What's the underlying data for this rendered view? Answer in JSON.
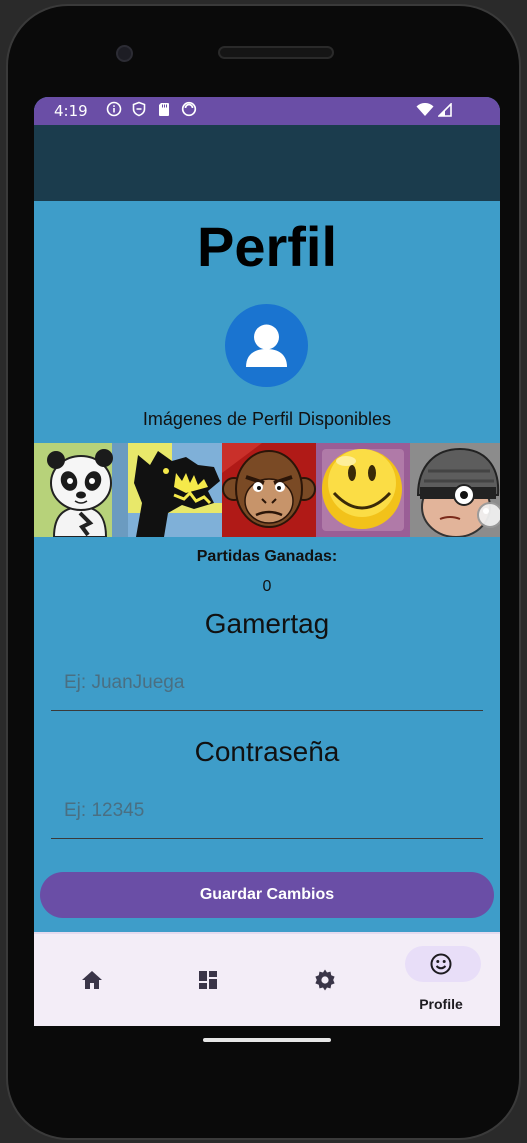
{
  "status_bar": {
    "time": "4:19",
    "icons": [
      "info-icon",
      "vpn-shield-icon",
      "sd-card-icon",
      "app-icon",
      "wifi-icon",
      "signal-icon"
    ],
    "color": "#6a4ea6"
  },
  "colors": {
    "app_bar": "#1b3c4d",
    "background": "#3e9dc9",
    "primary": "#6a4ea6",
    "nav_background": "#f3edf7",
    "avatar": "#1a74d0"
  },
  "profile": {
    "title": "Perfil",
    "avatar_icon": "person-icon",
    "available_images_label": "Imágenes de Perfil Disponibles",
    "images": [
      "panda-avatar",
      "dragon-avatar",
      "monkey-avatar",
      "smiley-avatar",
      "masked-kid-avatar"
    ],
    "wins_label": "Partidas Ganadas:",
    "wins_value": "0"
  },
  "form": {
    "gamertag_label": "Gamertag",
    "gamertag_placeholder": "Ej: JuanJuega",
    "gamertag_value": "",
    "password_label": "Contraseña",
    "password_placeholder": "Ej: 12345",
    "password_value": "",
    "save_label": "Guardar Cambios"
  },
  "nav": {
    "items": [
      {
        "icon": "home-icon",
        "label": ""
      },
      {
        "icon": "dashboard-icon",
        "label": ""
      },
      {
        "icon": "settings-icon",
        "label": ""
      },
      {
        "icon": "smiley-icon",
        "label": "Profile",
        "selected": true
      }
    ]
  }
}
